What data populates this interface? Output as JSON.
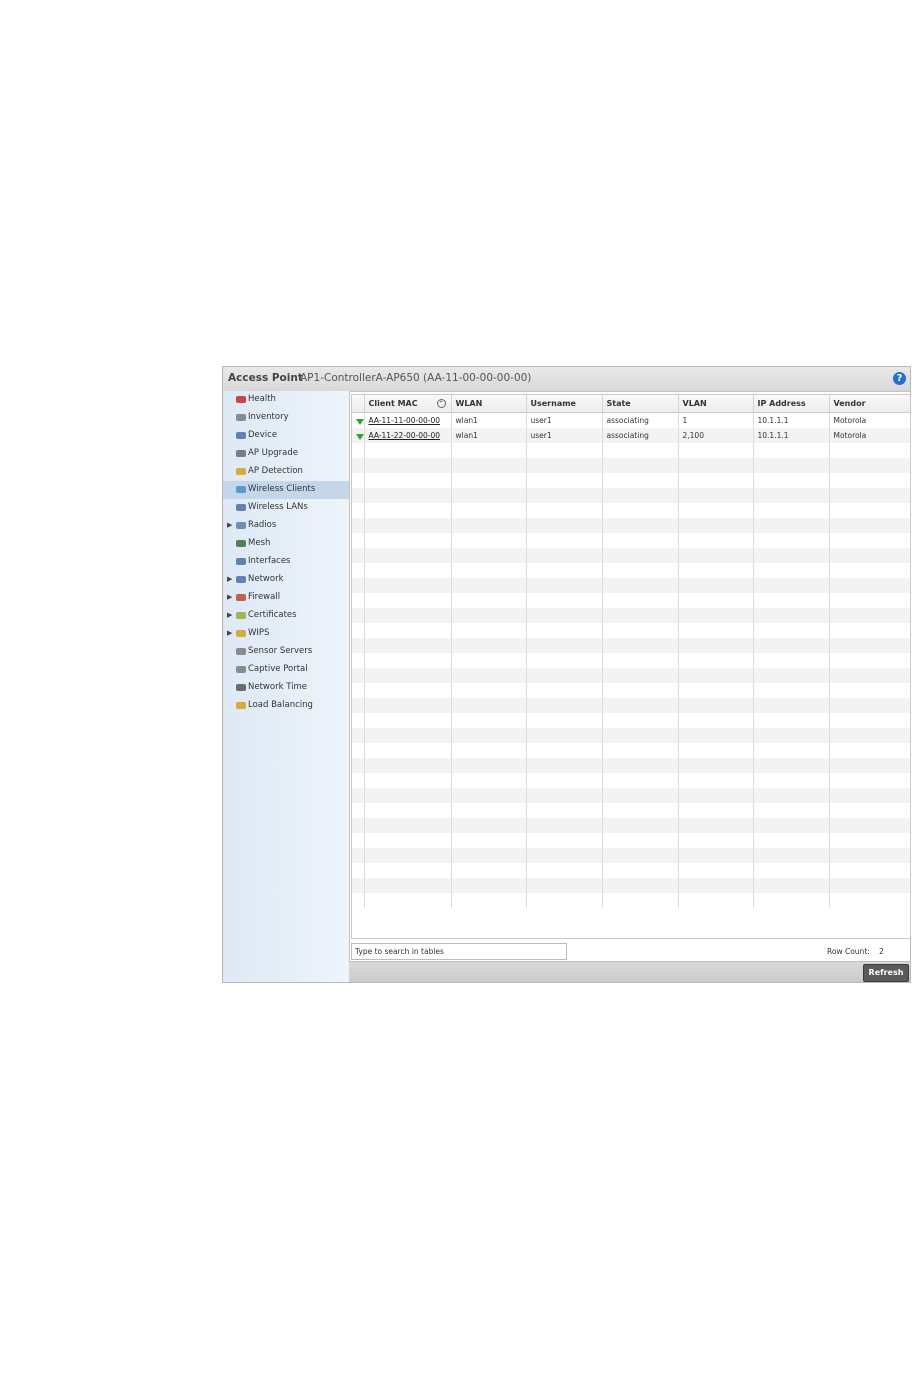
{
  "header": {
    "title": "Access Point",
    "subtitle": "AP1-ControllerA-AP650 (AA-11-00-00-00-00)"
  },
  "sidebar": {
    "items": [
      {
        "label": "Health",
        "icon": "heart-icon",
        "expandable": false
      },
      {
        "label": "Inventory",
        "icon": "inventory-icon",
        "expandable": false
      },
      {
        "label": "Device",
        "icon": "device-icon",
        "expandable": false
      },
      {
        "label": "AP Upgrade",
        "icon": "upgrade-icon",
        "expandable": false
      },
      {
        "label": "AP Detection",
        "icon": "detection-icon",
        "expandable": false
      },
      {
        "label": "Wireless Clients",
        "icon": "wireless-clients-icon",
        "expandable": false,
        "active": true
      },
      {
        "label": "Wireless LANs",
        "icon": "wlan-icon",
        "expandable": false
      },
      {
        "label": "Radios",
        "icon": "radio-icon",
        "expandable": true
      },
      {
        "label": "Mesh",
        "icon": "mesh-icon",
        "expandable": false
      },
      {
        "label": "Interfaces",
        "icon": "interfaces-icon",
        "expandable": false
      },
      {
        "label": "Network",
        "icon": "network-icon",
        "expandable": true
      },
      {
        "label": "Firewall",
        "icon": "firewall-icon",
        "expandable": true
      },
      {
        "label": "Certificates",
        "icon": "certificate-icon",
        "expandable": true
      },
      {
        "label": "WIPS",
        "icon": "wips-icon",
        "expandable": true
      },
      {
        "label": "Sensor Servers",
        "icon": "sensor-icon",
        "expandable": false
      },
      {
        "label": "Captive Portal",
        "icon": "portal-icon",
        "expandable": false
      },
      {
        "label": "Network Time",
        "icon": "clock-icon",
        "expandable": false
      },
      {
        "label": "Load Balancing",
        "icon": "balance-icon",
        "expandable": false
      }
    ]
  },
  "table": {
    "columns": [
      "Client MAC",
      "WLAN",
      "Username",
      "State",
      "VLAN",
      "IP Address",
      "Vendor"
    ],
    "rows": [
      [
        "AA-11-11-00-00-00",
        "wlan1",
        "user1",
        "associating",
        "1",
        "10.1.1.1",
        "Motorola"
      ],
      [
        "AA-11-22-00-00-00",
        "wlan1",
        "user1",
        "associating",
        "2,100",
        "10.1.1.1",
        "Motorola"
      ]
    ]
  },
  "search": {
    "placeholder": "Type to search in tables"
  },
  "footer": {
    "row_count_label": "Row Count:",
    "row_count_value": "2",
    "refresh_label": "Refresh"
  },
  "colors": {
    "sidebar": "#dde9f5",
    "active_item": "#c4d7ea",
    "status_ok": "#2ca52c",
    "help": "#1f6fd6"
  }
}
